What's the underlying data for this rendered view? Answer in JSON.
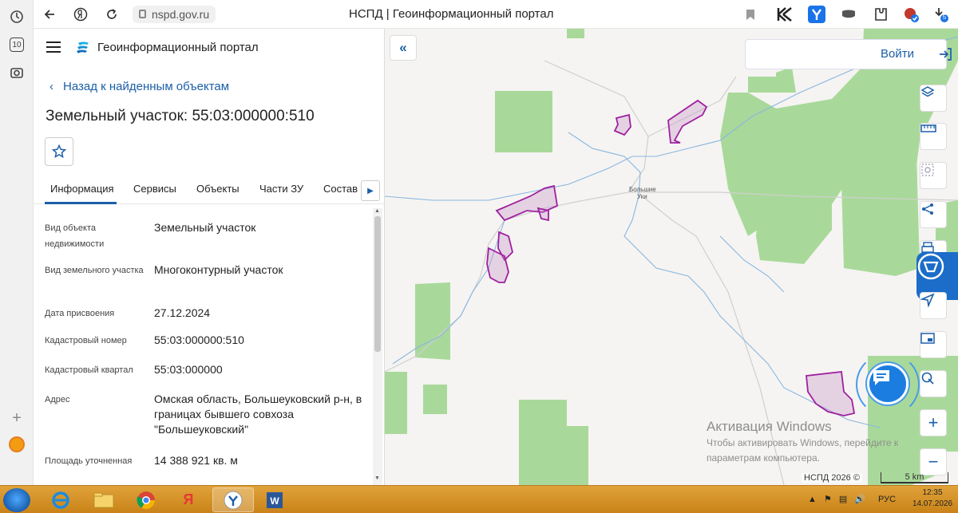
{
  "browser": {
    "url": "nspd.gov.ru",
    "page_title": "НСПД | Геоинформационный портал",
    "side_icons": [
      "history-icon",
      "tabs-counter-icon",
      "screenshot-icon",
      "add-icon",
      "yandex-panel-icon"
    ],
    "tabs_count": "10",
    "download_badge": "5"
  },
  "panel": {
    "portal_name": "Геоинформационный портал",
    "back_label": "Назад к найденным объектам",
    "title": "Земельный участок: 55:03:000000:510",
    "tabs": [
      "Информация",
      "Сервисы",
      "Объекты",
      "Части ЗУ",
      "Состав"
    ],
    "active_tab": "Информация",
    "rows": [
      {
        "label": "Вид объекта недвижимости",
        "value": "Земельный участок"
      },
      {
        "label": "Вид земельного участка",
        "value": "Многоконтурный участок"
      },
      {
        "label": "Дата присвоения",
        "value": "27.12.2024"
      },
      {
        "label": "Кадастровый номер",
        "value": "55:03:000000:510"
      },
      {
        "label": "Кадастровый квартал",
        "value": "55:03:000000"
      },
      {
        "label": "Адрес",
        "value": "Омская область, Большеуковский р-н, в границах бывшего совхоза \"Большеуковский\""
      },
      {
        "label": "Площадь уточненная",
        "value": "14 388 921 кв. м"
      }
    ]
  },
  "map": {
    "login_label": "Войти",
    "place_label_line1": "Большие",
    "place_label_line2": "Уки",
    "copyright": "НСПД 2026 ©",
    "scale_label": "5 km",
    "watermark_title": "Активация Windows",
    "watermark_line1": "Чтобы активировать Windows, перейдите к",
    "watermark_line2": "параметрам компьютера.",
    "tools": [
      "layers-icon",
      "ruler-icon",
      "select-area-icon",
      "share-icon",
      "print-icon",
      "navigate-icon",
      "minimap-icon",
      "geolocation-icon",
      "zoom-in-icon",
      "zoom-out-icon"
    ],
    "colors": {
      "forest": "#a9d99a",
      "parcel": "#a020a0",
      "river": "#6fa8dc",
      "road": "#c8c8c8",
      "accent": "#1c5fa8"
    }
  },
  "taskbar": {
    "apps": [
      "ie-icon",
      "explorer-icon",
      "chrome-icon",
      "yandex-icon",
      "yandex-browser-icon",
      "word-icon"
    ],
    "lang": "РУС",
    "time": "12:35",
    "date": "14.07.2026"
  }
}
